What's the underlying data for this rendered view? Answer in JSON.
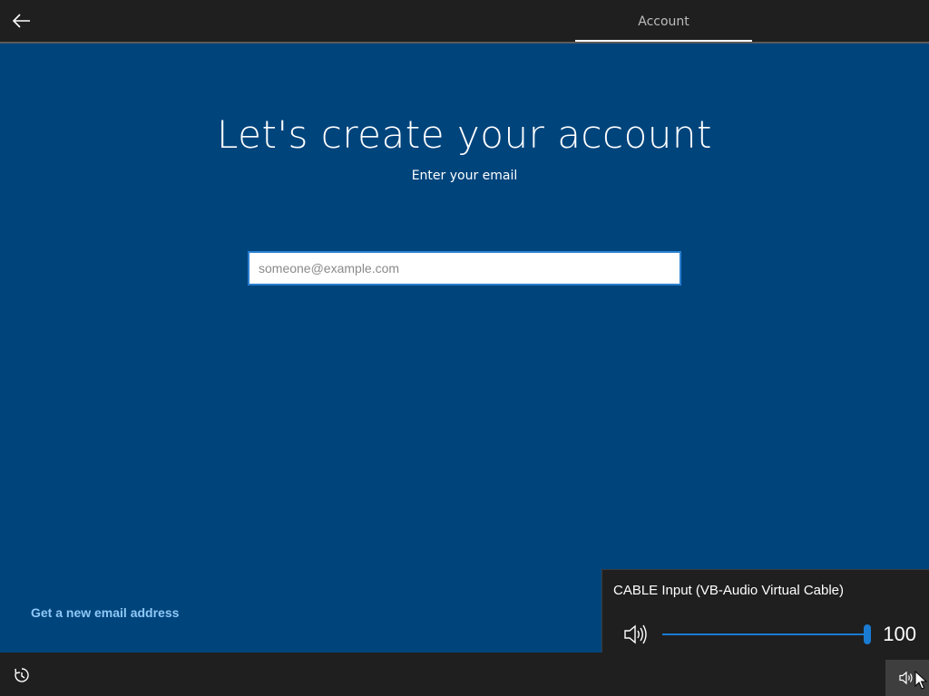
{
  "topbar": {
    "back_icon": "arrow-left-icon",
    "tab_label": "Account"
  },
  "main": {
    "title": "Let's create your account",
    "subtitle": "Enter your email",
    "email_input": {
      "value": "",
      "placeholder": "someone@example.com"
    },
    "new_email_link": "Get a new email address"
  },
  "bottombar": {
    "ease_of_access_icon": "ease-of-access-icon",
    "volume_icon": "speaker-icon"
  },
  "volume_flyout": {
    "device_name": "CABLE Input (VB-Audio Virtual Cable)",
    "volume_value": "100",
    "volume_level": 1.0,
    "speaker_icon": "speaker-icon"
  },
  "colors": {
    "background": "#00447c",
    "bar": "#1f1f1f",
    "accent": "#1a7bd2",
    "link": "#8ec8f6"
  }
}
